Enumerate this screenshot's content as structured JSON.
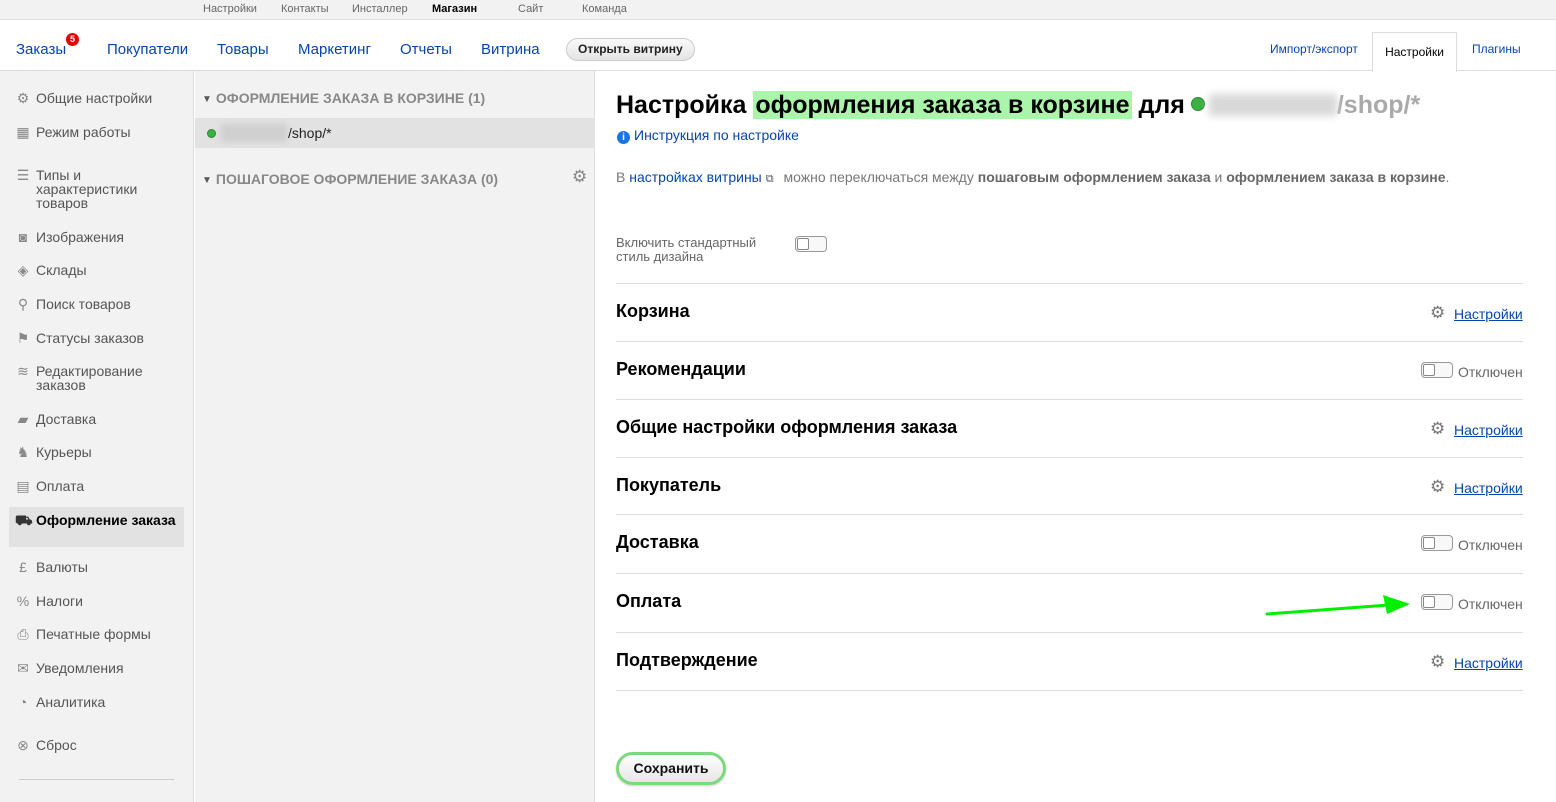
{
  "apps": [
    "Настройки",
    "Контакты",
    "Инсталлер",
    "Магазин",
    "Сайт",
    "Команда"
  ],
  "active_app": "Магазин",
  "nav": {
    "orders": "Заказы",
    "orders_badge": "5",
    "customers": "Покупатели",
    "products": "Товары",
    "marketing": "Маркетинг",
    "reports": "Отчеты",
    "storefront": "Витрина",
    "open_storefront": "Открыть витрину",
    "import_export": "Импорт/экспорт",
    "settings": "Настройки",
    "plugins": "Плагины"
  },
  "sidebar": {
    "items": [
      {
        "label": "Общие настройки",
        "icon": "sliders-icon"
      },
      {
        "label": "Режим работы",
        "icon": "calendar-icon"
      },
      {
        "label": "Типы и характеристики товаров",
        "icon": "list-icon"
      },
      {
        "label": "Изображения",
        "icon": "camera-icon"
      },
      {
        "label": "Склады",
        "icon": "box-icon"
      },
      {
        "label": "Поиск товаров",
        "icon": "search-icon"
      },
      {
        "label": "Статусы заказов",
        "icon": "flag-icon"
      },
      {
        "label": "Редактирование заказов",
        "icon": "layers-icon"
      },
      {
        "label": "Доставка",
        "icon": "truck-icon"
      },
      {
        "label": "Курьеры",
        "icon": "runner-icon"
      },
      {
        "label": "Оплата",
        "icon": "money-icon"
      },
      {
        "label": "Оформление заказа",
        "icon": "cart-icon"
      },
      {
        "label": "Валюты",
        "icon": "pound-icon"
      },
      {
        "label": "Налоги",
        "icon": "percent-icon"
      },
      {
        "label": "Печатные формы",
        "icon": "printer-icon"
      },
      {
        "label": "Уведомления",
        "icon": "envelope-icon"
      },
      {
        "label": "Аналитика",
        "icon": "gauge-icon"
      },
      {
        "label": "Сброс",
        "icon": "reset-icon"
      }
    ],
    "active": "Оформление заказа"
  },
  "middle": {
    "group1": "ОФОРМЛЕНИЕ ЗАКАЗА В КОРЗИНЕ (1)",
    "group1_item_path": "/shop/*",
    "group2": "ПОШАГОВОЕ ОФОРМЛЕНИЕ ЗАКАЗА (0)"
  },
  "content": {
    "title_part1": "Настройка",
    "title_highlight": "оформления заказа в корзине",
    "title_part2": "для",
    "title_path": "/shop/*",
    "instruction": "Инструкция по настройке",
    "desc_prefix": "В",
    "desc_link": "настройках витрины",
    "desc_mid": "можно переключаться между",
    "desc_bold1": "пошаговым оформлением заказа",
    "desc_and": "и",
    "desc_bold2": "оформлением заказа в корзине",
    "desc_end": ".",
    "std_style_label": "Включить стандартный стиль дизайна",
    "rows": [
      {
        "name": "Корзина",
        "action": "Настройки"
      },
      {
        "name": "Рекомендации",
        "status": "Отключен"
      },
      {
        "name": "Общие настройки оформления заказа",
        "action": "Настройки"
      },
      {
        "name": "Покупатель",
        "action": "Настройки"
      },
      {
        "name": "Доставка",
        "status": "Отключен"
      },
      {
        "name": "Оплата",
        "status": "Отключен"
      },
      {
        "name": "Подтверждение",
        "action": "Настройки"
      }
    ],
    "save": "Сохранить"
  },
  "colors": {
    "link": "#0645ad",
    "highlight": "#a9f5a9",
    "arrow": "#00ee00",
    "badge": "#e60000"
  }
}
